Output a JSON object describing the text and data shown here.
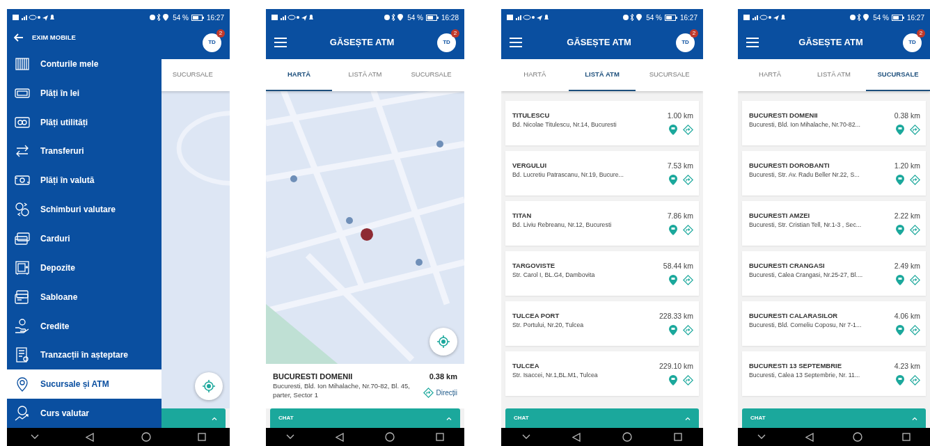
{
  "screens": [
    {
      "kind": "menu",
      "status": {
        "battery": "54 %",
        "time": "16:27"
      },
      "header": {
        "avatar": "TD",
        "badge": "2"
      },
      "tabs": [
        {
          "label": "SUCURSALE",
          "selected": false
        }
      ],
      "drawer": {
        "title": "EXIM MOBILE",
        "items": [
          {
            "label": "Conturile mele",
            "selected": false
          },
          {
            "label": "Plăți în lei",
            "selected": false
          },
          {
            "label": "Plăți utilități",
            "selected": false
          },
          {
            "label": "Transferuri",
            "selected": false
          },
          {
            "label": "Plăți în valută",
            "selected": false
          },
          {
            "label": "Schimburi valutare",
            "selected": false
          },
          {
            "label": "Carduri",
            "selected": false
          },
          {
            "label": "Depozite",
            "selected": false
          },
          {
            "label": "Sabloane",
            "selected": false
          },
          {
            "label": "Credite",
            "selected": false
          },
          {
            "label": "Tranzacții în așteptare",
            "selected": false
          },
          {
            "label": "Sucursale și ATM",
            "selected": true
          },
          {
            "label": "Curs valutar",
            "selected": false
          }
        ]
      }
    },
    {
      "kind": "map",
      "status": {
        "battery": "54 %",
        "time": "16:28"
      },
      "header": {
        "title": "GĂSEȘTE ATM",
        "avatar": "TD",
        "badge": "2"
      },
      "tabs": [
        {
          "label": "HARTĂ",
          "selected": true
        },
        {
          "label": "LISTĂ ATM",
          "selected": false
        },
        {
          "label": "SUCURSALE",
          "selected": false
        }
      ],
      "place": {
        "name": "BUCURESTI DOMENII",
        "address": "Bucuresti, Bld. Ion Mihalache, Nr.70-82, Bl. 45, parter, Sector 1",
        "distance": "0.38 km",
        "link": "Direcții"
      },
      "chat": {
        "label": "CHAT"
      }
    },
    {
      "kind": "list",
      "status": {
        "battery": "54 %",
        "time": "16:27"
      },
      "header": {
        "title": "GĂSEȘTE ATM",
        "avatar": "TD",
        "badge": "2"
      },
      "tabs": [
        {
          "label": "HARTĂ",
          "selected": false
        },
        {
          "label": "LISTĂ ATM",
          "selected": true
        },
        {
          "label": "SUCURSALE",
          "selected": false
        }
      ],
      "items": [
        {
          "name": "TITULESCU",
          "address": "Bd. Nicolae Titulescu, Nr.14, Bucuresti",
          "distance": "1.00 km"
        },
        {
          "name": "VERGULUI",
          "address": "Bd. Lucretiu Patrascanu, Nr.19, Bucure...",
          "distance": "7.53 km"
        },
        {
          "name": "TITAN",
          "address": "Bd. Liviu Rebreanu, Nr.12, Bucuresti",
          "distance": "7.86 km"
        },
        {
          "name": "TARGOVISTE",
          "address": "Str. Carol I, BL.G4, Dambovita",
          "distance": "58.44 km"
        },
        {
          "name": "TULCEA PORT",
          "address": "Str. Portului, Nr.20, Tulcea",
          "distance": "228.33 km"
        },
        {
          "name": "TULCEA",
          "address": "Str. Isaccei, Nr.1,BL.M1, Tulcea",
          "distance": "229.10 km"
        }
      ],
      "chat": {
        "label": "CHAT"
      }
    },
    {
      "kind": "list",
      "status": {
        "battery": "54 %",
        "time": "16:27"
      },
      "header": {
        "title": "GĂSEȘTE ATM",
        "avatar": "TD",
        "badge": "2"
      },
      "tabs": [
        {
          "label": "HARTĂ",
          "selected": false
        },
        {
          "label": "LISTĂ ATM",
          "selected": false
        },
        {
          "label": "SUCURSALE",
          "selected": true
        }
      ],
      "items": [
        {
          "name": "BUCURESTI DOMENII",
          "address": "Bucuresti, Bld. Ion Mihalache, Nr.70-82...",
          "distance": "0.38 km"
        },
        {
          "name": "BUCURESTI DOROBANTI",
          "address": "Bucuresti, Str. Av. Radu Beller Nr.22, S...",
          "distance": "1.20 km"
        },
        {
          "name": "BUCURESTI AMZEI",
          "address": "Bucuresti, Str. Cristian Tell, Nr.1-3 , Sec...",
          "distance": "2.22 km"
        },
        {
          "name": "BUCURESTI CRANGASI",
          "address": "Bucuresti, Calea Crangasi, Nr.25-27, Bl....",
          "distance": "2.49 km"
        },
        {
          "name": "BUCURESTI CALARASILOR",
          "address": "Bucuresti, Bld. Corneliu Coposu, Nr 7-1...",
          "distance": "4.06 km"
        },
        {
          "name": "BUCURESTI 13 SEPTEMBRIE",
          "address": "Bucuresti, Calea 13 Septembrie, Nr. 11...",
          "distance": "4.23 km"
        }
      ],
      "chat": {
        "label": "CHAT"
      }
    }
  ]
}
